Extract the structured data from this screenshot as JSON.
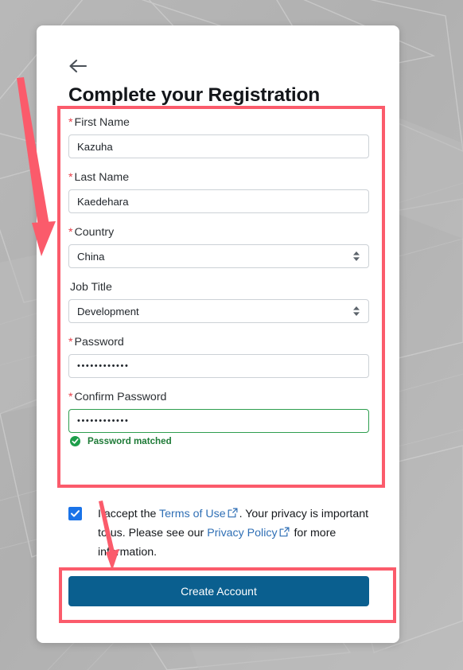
{
  "window": {
    "background_color": "#b3b3b3",
    "card_background": "#ffffff"
  },
  "header": {
    "back_icon": "arrow-left-icon",
    "title": "Complete your Registration"
  },
  "form": {
    "fields": [
      {
        "id": "first-name",
        "label": "First Name",
        "required": true,
        "required_marker": "*",
        "type": "text",
        "value": "Kazuha",
        "placeholder": ""
      },
      {
        "id": "last-name",
        "label": "Last Name",
        "required": true,
        "required_marker": "*",
        "type": "text",
        "value": "Kaedehara",
        "placeholder": ""
      },
      {
        "id": "country",
        "label": "Country",
        "required": true,
        "required_marker": "*",
        "type": "select",
        "value": "China",
        "placeholder": ""
      },
      {
        "id": "job-title",
        "label": "Job Title",
        "required": false,
        "required_marker": "",
        "type": "select",
        "value": "Development",
        "placeholder": ""
      },
      {
        "id": "password",
        "label": "Password",
        "required": true,
        "required_marker": "*",
        "type": "password",
        "value": "••••••••••••",
        "placeholder": ""
      },
      {
        "id": "confirm-password",
        "label": "Confirm Password",
        "required": true,
        "required_marker": "*",
        "type": "password",
        "value": "••••••••••••",
        "placeholder": ""
      }
    ],
    "validation": {
      "icon": "check-circle-icon",
      "message": "Password matched",
      "color": "#1d7a36"
    }
  },
  "terms": {
    "checkbox_checked": true,
    "checkbox_color": "#1a73e8",
    "text_before_terms": "I accept the ",
    "terms_link": "Terms of Use",
    "external_icon": "external-link-icon",
    "text_middle": ". Your privacy is important to us. Please see our ",
    "privacy_link": "Privacy Policy",
    "text_after": " for more information.",
    "link_color": "#2f6fb5"
  },
  "actions": {
    "create_account_label": "Create Account",
    "create_account_color": "#0a5f8f"
  },
  "annotations": {
    "highlight_color": "#fb5b6b",
    "boxes": [
      {
        "name": "form-fields-highlight"
      },
      {
        "name": "create-account-highlight"
      }
    ],
    "arrows": [
      {
        "name": "arrow-to-form-fields"
      },
      {
        "name": "arrow-to-create-account"
      }
    ]
  }
}
